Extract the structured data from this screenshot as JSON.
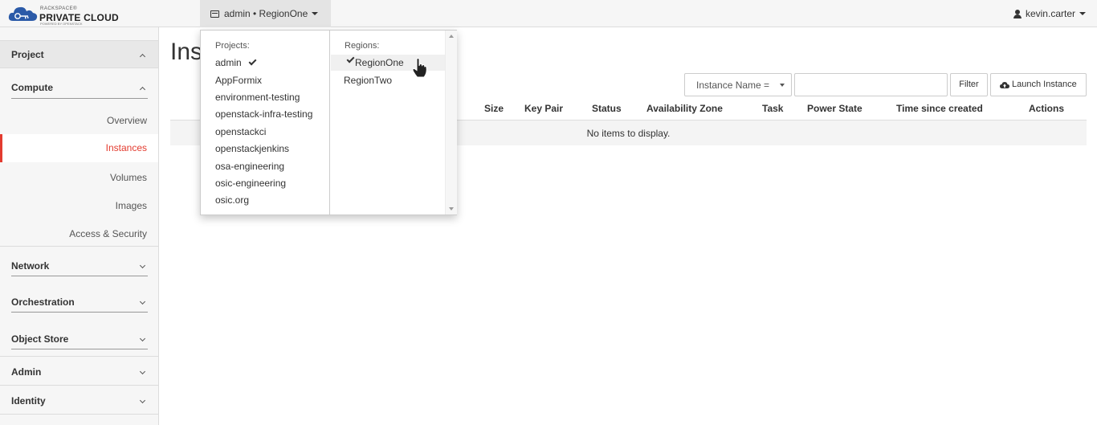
{
  "header": {
    "brand_small": "RACKSPACE®",
    "brand_main": "PRIVATE CLOUD",
    "brand_powered": "POWERED BY OPENSTACK",
    "context_label": "admin • RegionOne",
    "user_label": "kevin.carter"
  },
  "sidebar": {
    "project": "Project",
    "compute": "Compute",
    "items": [
      "Overview",
      "Instances",
      "Volumes",
      "Images",
      "Access & Security"
    ],
    "network": "Network",
    "orchestration": "Orchestration",
    "object_store": "Object Store",
    "admin": "Admin",
    "identity": "Identity",
    "active_color": "#e33b2f"
  },
  "main": {
    "title": "Ins",
    "filter_select": "Instance Name =",
    "filter_value": "",
    "filter_button": "Filter",
    "launch_button": "Launch Instance",
    "columns": [
      "Size",
      "Key Pair",
      "Status",
      "Availability Zone",
      "Task",
      "Power State",
      "Time since created",
      "Actions"
    ],
    "empty_text": "No items to display."
  },
  "dropdown": {
    "projects_label": "Projects:",
    "projects": [
      "admin",
      "AppFormix",
      "environment-testing",
      "openstack-infra-testing",
      "openstackci",
      "openstackjenkins",
      "osa-engineering",
      "osic-engineering",
      "osic.org"
    ],
    "selected_project": "admin",
    "regions_label": "Regions:",
    "regions": [
      "RegionOne",
      "RegionTwo"
    ],
    "selected_region": "RegionOne"
  }
}
